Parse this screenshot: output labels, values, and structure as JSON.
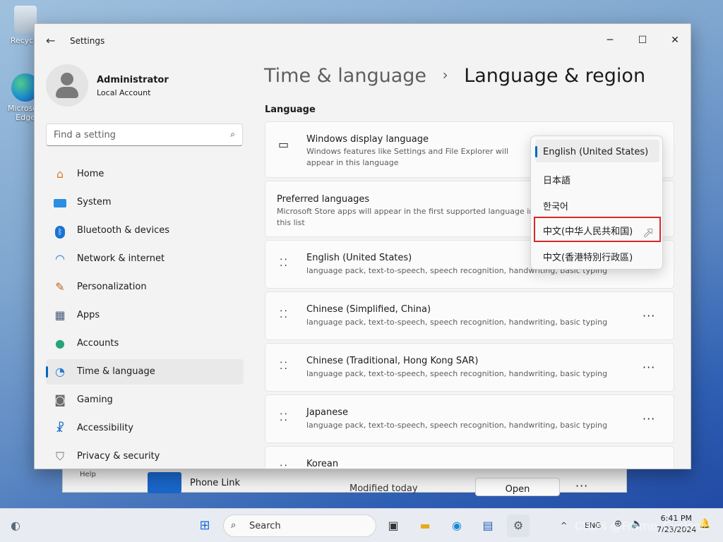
{
  "desktop": {
    "icons": [
      {
        "label": "Recycle",
        "icon": "recycle-bin-icon"
      },
      {
        "label": "Microsoft Edge",
        "icon": "edge-icon"
      }
    ]
  },
  "background_window": {
    "help": "Help",
    "app_name": "Phone Link",
    "modified": "Modified today",
    "open_button": "Open",
    "more": "···"
  },
  "window": {
    "title": "Settings",
    "controls": {
      "minimize": "─",
      "maximize": "☐",
      "close": "✕"
    }
  },
  "user": {
    "name": "Administrator",
    "account_type": "Local Account"
  },
  "search": {
    "placeholder": "Find a setting"
  },
  "nav": {
    "items": [
      {
        "label": "Home",
        "icon": "home-icon"
      },
      {
        "label": "System",
        "icon": "system-icon"
      },
      {
        "label": "Bluetooth & devices",
        "icon": "bluetooth-icon"
      },
      {
        "label": "Network & internet",
        "icon": "network-icon"
      },
      {
        "label": "Personalization",
        "icon": "brush-icon"
      },
      {
        "label": "Apps",
        "icon": "apps-icon"
      },
      {
        "label": "Accounts",
        "icon": "accounts-icon"
      },
      {
        "label": "Time & language",
        "icon": "time-language-icon",
        "selected": true
      },
      {
        "label": "Gaming",
        "icon": "gaming-icon"
      },
      {
        "label": "Accessibility",
        "icon": "accessibility-icon"
      },
      {
        "label": "Privacy & security",
        "icon": "shield-icon"
      }
    ]
  },
  "breadcrumb": {
    "parent": "Time & language",
    "separator": "›",
    "current": "Language & region"
  },
  "section_language": "Language",
  "display_language": {
    "title": "Windows display language",
    "description": "Windows features like Settings and File Explorer will appear in this language"
  },
  "preferred": {
    "title": "Preferred languages",
    "description": "Microsoft Store apps will appear in the first supported language in this list"
  },
  "languages": [
    {
      "name": "English (United States)",
      "features": "language pack, text-to-speech, speech recognition, handwriting, basic typing"
    },
    {
      "name": "Chinese (Simplified, China)",
      "features": "language pack, text-to-speech, speech recognition, handwriting, basic typing"
    },
    {
      "name": "Chinese (Traditional, Hong Kong SAR)",
      "features": "language pack, text-to-speech, speech recognition, handwriting, basic typing"
    },
    {
      "name": "Japanese",
      "features": "language pack, text-to-speech, speech recognition, handwriting, basic typing"
    },
    {
      "name": "Korean",
      "features": ""
    }
  ],
  "more_button": "···",
  "dropdown": {
    "options": [
      {
        "label": "English (United States)",
        "selected": true
      },
      {
        "label": "日本語"
      },
      {
        "label": "한국어"
      },
      {
        "label": "中文(中华人民共和国)",
        "highlighted": true
      },
      {
        "label": "中文(香港特別行政區)"
      }
    ]
  },
  "taskbar": {
    "search_label": "Search",
    "tray": {
      "chevron": "^",
      "lang": "ENG"
    },
    "clock": {
      "time": "6:41 PM",
      "date": "7/23/2024"
    }
  },
  "watermark": "CSDN @Frame_Cyclone",
  "colors": {
    "accent": "#0067c0",
    "highlight_border": "#d42a2a",
    "window_bg": "#f3f3f3",
    "card_bg": "#fbfbfb"
  }
}
